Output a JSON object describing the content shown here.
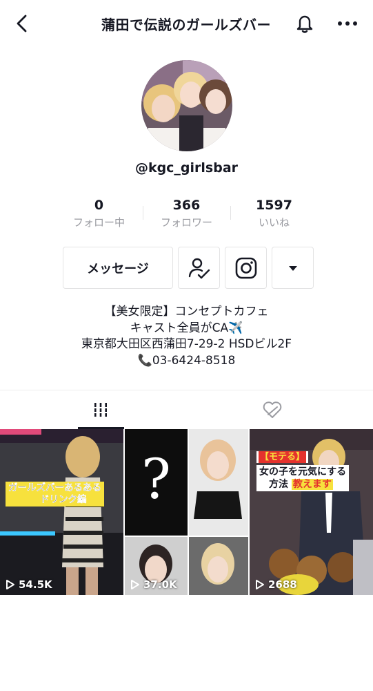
{
  "header": {
    "title": "蒲田で伝説のガールズバー"
  },
  "profile": {
    "username": "@kgc_girlsbar"
  },
  "stats": [
    {
      "value": "0",
      "label": "フォロー中"
    },
    {
      "value": "366",
      "label": "フォロワー"
    },
    {
      "value": "1597",
      "label": "いいね"
    }
  ],
  "actions": {
    "message_label": "メッセージ"
  },
  "bio": {
    "line1": "【美女限定】コンセプトカフェ",
    "line2": "キャスト全員がCA✈️",
    "line3": "東京都大田区西蒲田7-29-2 HSDビル2F",
    "line4": "📞03-6424-8518"
  },
  "videos": [
    {
      "caption_line1": "ガールズバーあるある",
      "caption_line2": "ドリンク編",
      "views": "54.5K"
    },
    {
      "caption_mark": "?",
      "views": "37.0K"
    },
    {
      "caption_tag": "【モテる】",
      "caption_line1": "女の子を元気にする",
      "caption_line2a": "方法",
      "caption_line2b": "教えます",
      "views": "2688"
    }
  ],
  "colors": {
    "text": "#161823",
    "muted": "#9a9ba1",
    "border": "#e3e3e4",
    "caption_yellow": "#f7e13d",
    "caption_red": "#e5322d"
  }
}
